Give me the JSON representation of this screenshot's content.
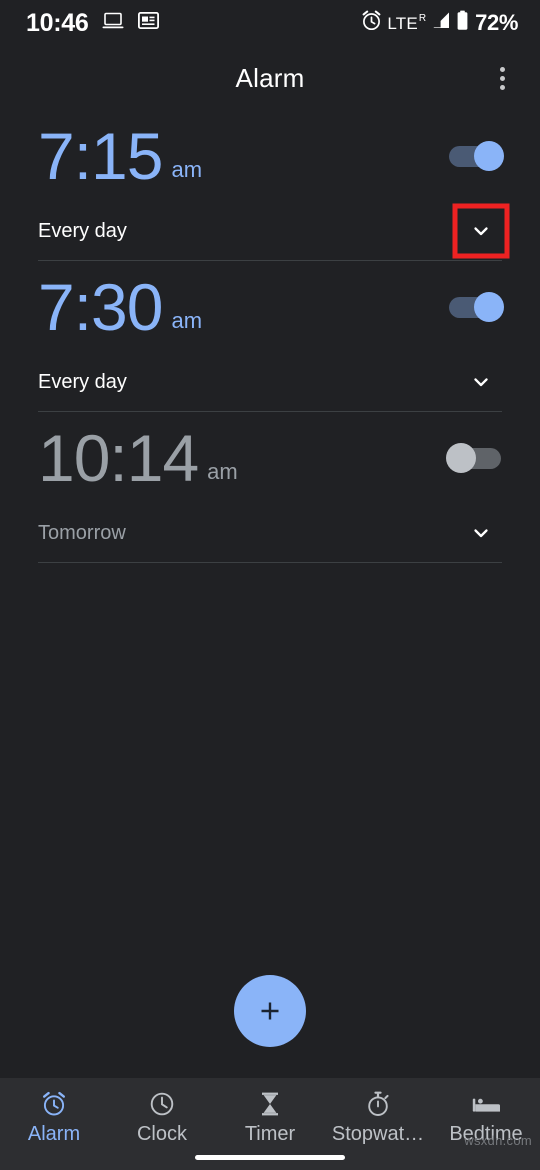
{
  "status_bar": {
    "time": "10:46",
    "left_icons": [
      "laptop-cast-icon",
      "news-card-icon"
    ],
    "right_icons": [
      "alarm-set-icon",
      "signal-icon",
      "battery-icon"
    ],
    "network": "LTE",
    "network_superscript": "R",
    "battery_percent": "72%"
  },
  "app_bar": {
    "title": "Alarm",
    "overflow_label": "More options"
  },
  "alarms": [
    {
      "time": "7:15",
      "meridiem": "am",
      "schedule": "Every day",
      "enabled": true,
      "expand_icon": "chevron-down-icon",
      "highlighted": true
    },
    {
      "time": "7:30",
      "meridiem": "am",
      "schedule": "Every day",
      "enabled": true,
      "expand_icon": "chevron-down-icon",
      "highlighted": false
    },
    {
      "time": "10:14",
      "meridiem": "am",
      "schedule": "Tomorrow",
      "enabled": false,
      "expand_icon": "chevron-down-icon",
      "highlighted": false
    }
  ],
  "fab": {
    "label": "+",
    "icon": "plus-icon"
  },
  "bottom_nav": {
    "items": [
      {
        "label": "Alarm",
        "icon": "alarm-clock-icon",
        "active": true
      },
      {
        "label": "Clock",
        "icon": "clock-icon",
        "active": false
      },
      {
        "label": "Timer",
        "icon": "hourglass-icon",
        "active": false
      },
      {
        "label": "Stopwat…",
        "icon": "stopwatch-icon",
        "active": false
      },
      {
        "label": "Bedtime",
        "icon": "bed-icon",
        "active": false
      }
    ]
  },
  "watermark": "wsxdn.com",
  "colors": {
    "background": "#202124",
    "nav_background": "#2d2e31",
    "accent": "#8ab4f8",
    "disabled": "#9aa0a6",
    "divider": "#3c4043",
    "highlight_box": "#ee2222"
  }
}
